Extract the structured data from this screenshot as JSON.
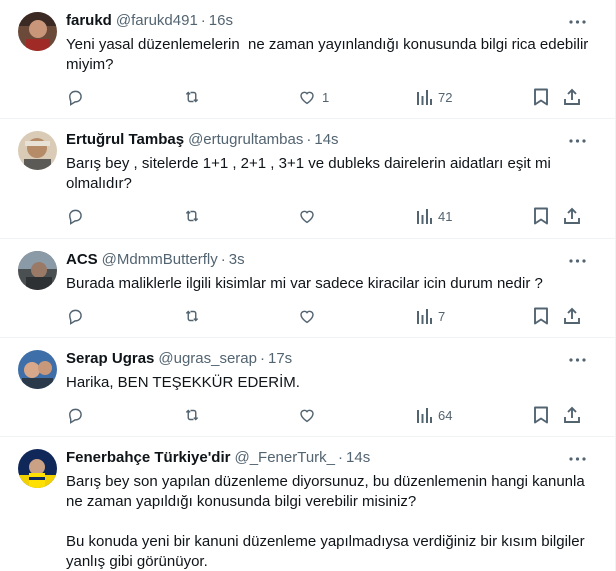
{
  "tweets": [
    {
      "name": "farukd",
      "handle": "@farukd491",
      "time": "16s",
      "text": "Yeni yasal düzenlemelerin  ne zaman yayınlandığı konusunda bilgi rica edebilir miyim?",
      "likes": "1",
      "views": "72"
    },
    {
      "name": "Ertuğrul Tambaş",
      "handle": "@ertugrultambas",
      "time": "14s",
      "text": "Barış bey , sitelerde 1+1 , 2+1 , 3+1 ve dubleks dairelerin aidatları eşit mi olmalıdır?",
      "likes": "",
      "views": "41"
    },
    {
      "name": "ACS",
      "handle": "@MdmmButterfly",
      "time": "3s",
      "text": "Burada maliklerle ilgili kisimlar mi var sadece kiracilar icin durum nedir ?",
      "likes": "",
      "views": "7"
    },
    {
      "name": "Serap Ugras",
      "handle": "@ugras_serap",
      "time": "17s",
      "text": "Harika, BEN TEŞEKKÜR EDERİM.",
      "likes": "",
      "views": "64"
    },
    {
      "name": "Fenerbahçe Türkiye'dir",
      "handle": "@_FenerTurk_",
      "time": "14s",
      "text": "Barış bey son yapılan düzenleme diyorsunuz, bu düzenlemenin hangi kanunla ne zaman yapıldığı konusunda bilgi verebilir misiniz?\n\nBu konuda yeni bir kanuni düzenleme yapılmadıysa verdiğiniz bir kısım bilgiler yanlış gibi görünüyor.",
      "likes": "",
      "views": ""
    }
  ],
  "separator": "·",
  "icons": {
    "more": "more-dots-icon",
    "reply": "reply-icon",
    "retweet": "retweet-icon",
    "like": "heart-icon",
    "views": "views-chart-icon",
    "bookmark": "bookmark-icon",
    "share": "share-icon"
  },
  "colors": {
    "text": "#0f1419",
    "secondary": "#536471",
    "border": "#eff3f4"
  }
}
